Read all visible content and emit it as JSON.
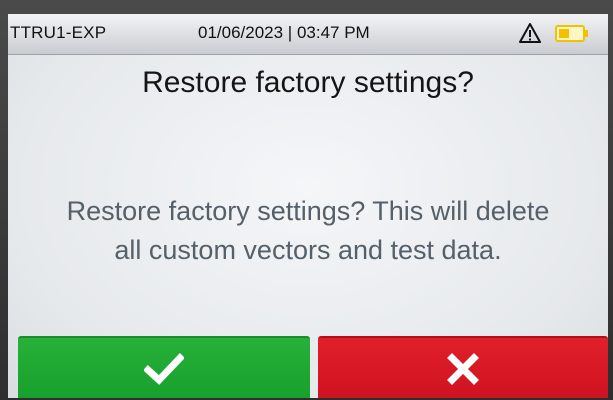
{
  "status_bar": {
    "device_name": "TTRU1-EXP",
    "datetime": "01/06/2023 | 03:47 PM",
    "warning_icon": "warning-triangle-icon",
    "battery_icon": "battery-icon",
    "battery_color": "#f2c200"
  },
  "dialog": {
    "title": "Restore factory settings?",
    "message_line1": "Restore factory settings? This will delete",
    "message_line2": "all custom vectors and test data."
  },
  "buttons": {
    "confirm": {
      "icon": "checkmark-icon",
      "color": "#1fa831"
    },
    "cancel": {
      "icon": "close-icon",
      "color": "#d91a24"
    }
  }
}
